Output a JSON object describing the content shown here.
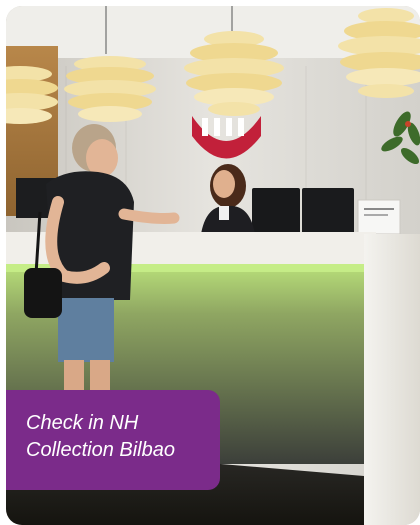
{
  "caption": {
    "line1": "Check in NH",
    "line2": "Collection Bilbao"
  },
  "colors": {
    "caption_background": "#7b2b8a",
    "caption_text": "#ffffff",
    "led_glow": "#c8f08a",
    "lamp_shade": "#f3e2a8",
    "counter_front": "#4a4c46",
    "brand_red": "#c2203a"
  },
  "photo": {
    "description_icons": [
      "pendant-lamp-icon",
      "hotel-logo-icon"
    ]
  }
}
